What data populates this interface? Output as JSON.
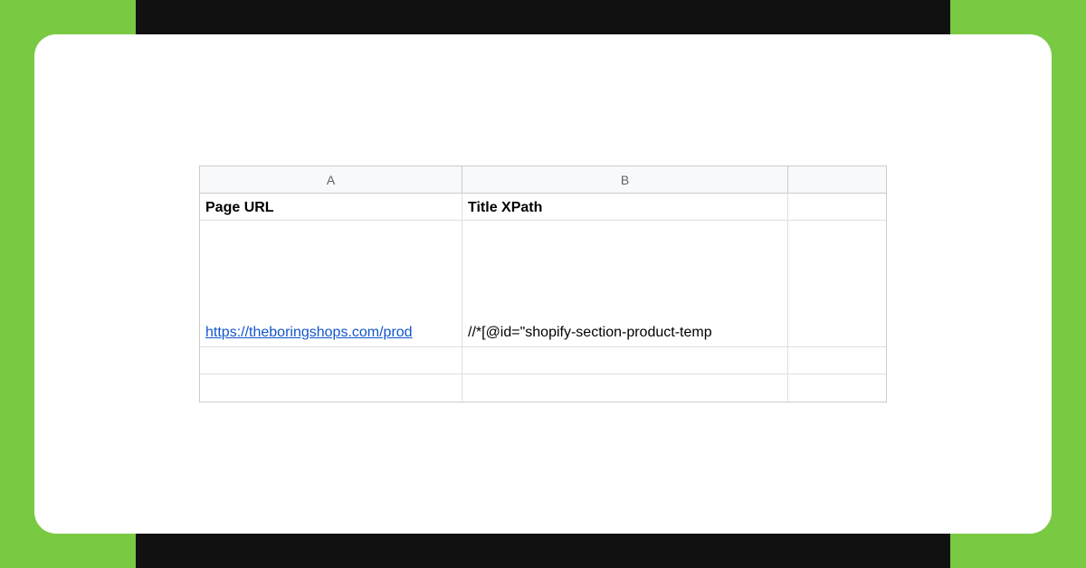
{
  "columns": {
    "a": "A",
    "b": "B"
  },
  "headers": {
    "col_a": "Page URL",
    "col_b": "Title XPath"
  },
  "row_data": {
    "url": "https://theboringshops.com/prod",
    "xpath": "//*[@id=\"shopify-section-product-temp"
  }
}
